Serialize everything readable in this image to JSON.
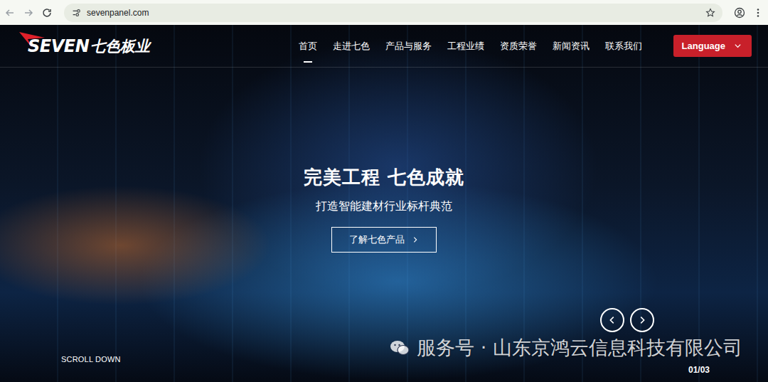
{
  "browser": {
    "url": "sevenpanel.com"
  },
  "header": {
    "logo": {
      "mark": "SEVEN",
      "name": "七色板业"
    },
    "nav": [
      {
        "label": "首页",
        "selected": true
      },
      {
        "label": "走进七色",
        "selected": false
      },
      {
        "label": "产品与服务",
        "selected": false
      },
      {
        "label": "工程业绩",
        "selected": false
      },
      {
        "label": "资质荣誉",
        "selected": false
      },
      {
        "label": "新闻资讯",
        "selected": false
      },
      {
        "label": "联系我们",
        "selected": false
      }
    ],
    "language": {
      "label": "Language"
    }
  },
  "hero": {
    "title": "完美工程 七色成就",
    "subtitle": "打造智能建材行业标杆典范",
    "button": {
      "label": "了解七色产品"
    },
    "scroll_hint": "SCROLL DOWN",
    "counter": "01/03"
  },
  "watermark": {
    "text": "服务号 · 山东京鸿云信息科技有限公司"
  }
}
